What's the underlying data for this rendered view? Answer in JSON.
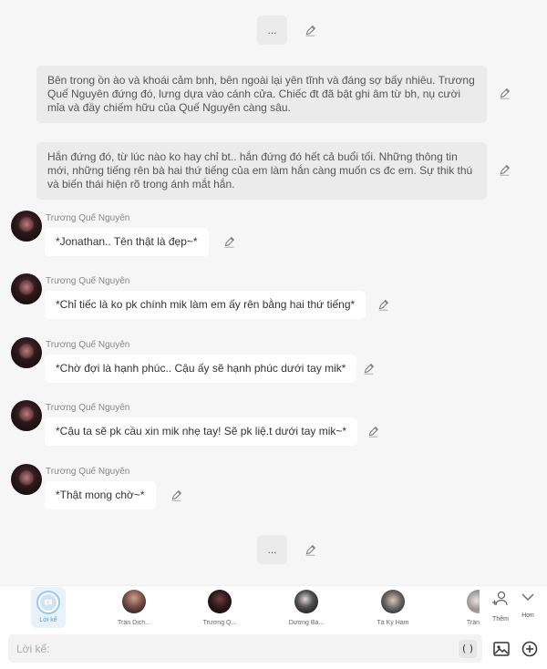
{
  "chat": {
    "top_ellipsis": "...",
    "bottom_ellipsis": "...",
    "narrations": [
      {
        "text": "Bên trong ồn ào và khoái cảm bnh, bên ngoài lại yên tĩnh và đáng sợ bấy nhiêu. Trương Quế Nguyên đứng đó, lưng dựa vào cánh cửa. Chiếc đt đã bật ghi âm từ bh, nụ cười mỉa và đầy chiếm hữu của Quế Nguyên càng sâu."
      },
      {
        "text": "Hắn đứng đó, từ lúc nào ko hay chỉ bt.. hắn đứng đó hết cả buổi tối. Những thông tin mới, những tiếng rên bà hai thứ tiếng của em làm hắn càng muốn cs đc em. Sự thik thú và biến thái hiện rõ trong ánh mắt hắn."
      }
    ],
    "messages": [
      {
        "sender": "Trương Quế Nguyên",
        "text": "*Jonathan.. Tên thật là đẹp~*"
      },
      {
        "sender": "Trương Quế Nguyên",
        "text": "*Chỉ tiếc là ko pk chính mik làm em ấy rên bằng hai thứ tiếng*"
      },
      {
        "sender": "Trương Quế Nguyên",
        "text": "*Chờ đợi là hạnh phúc.. Cậu ấy sẽ hạnh phúc dưới tay mik*"
      },
      {
        "sender": "Trương Quế Nguyên",
        "text": "*Cậu ta sẽ pk cầu xin mik nhẹ tay! Sẽ pk liệ.t dưới tay mik~*"
      },
      {
        "sender": "Trương Quế Nguyên",
        "text": "*Thật mong chờ~*"
      }
    ]
  },
  "character_bar": {
    "narrator_label": "Lời kể",
    "characters": [
      {
        "name": "Trần Dịch..."
      },
      {
        "name": "Trương Q..."
      },
      {
        "name": "Dương Bá..."
      },
      {
        "name": "Tả Kỳ Hàm"
      },
      {
        "name": "Trần"
      }
    ],
    "add_label": "Thêm",
    "more_label": "Hơn"
  },
  "input": {
    "placeholder": "Lời kể:",
    "paren_label": "( )"
  },
  "colors": {
    "background": "#f6f6f6",
    "bubble": "#ffffff",
    "narration": "#ebebeb",
    "accent": "#5a9bd6"
  }
}
